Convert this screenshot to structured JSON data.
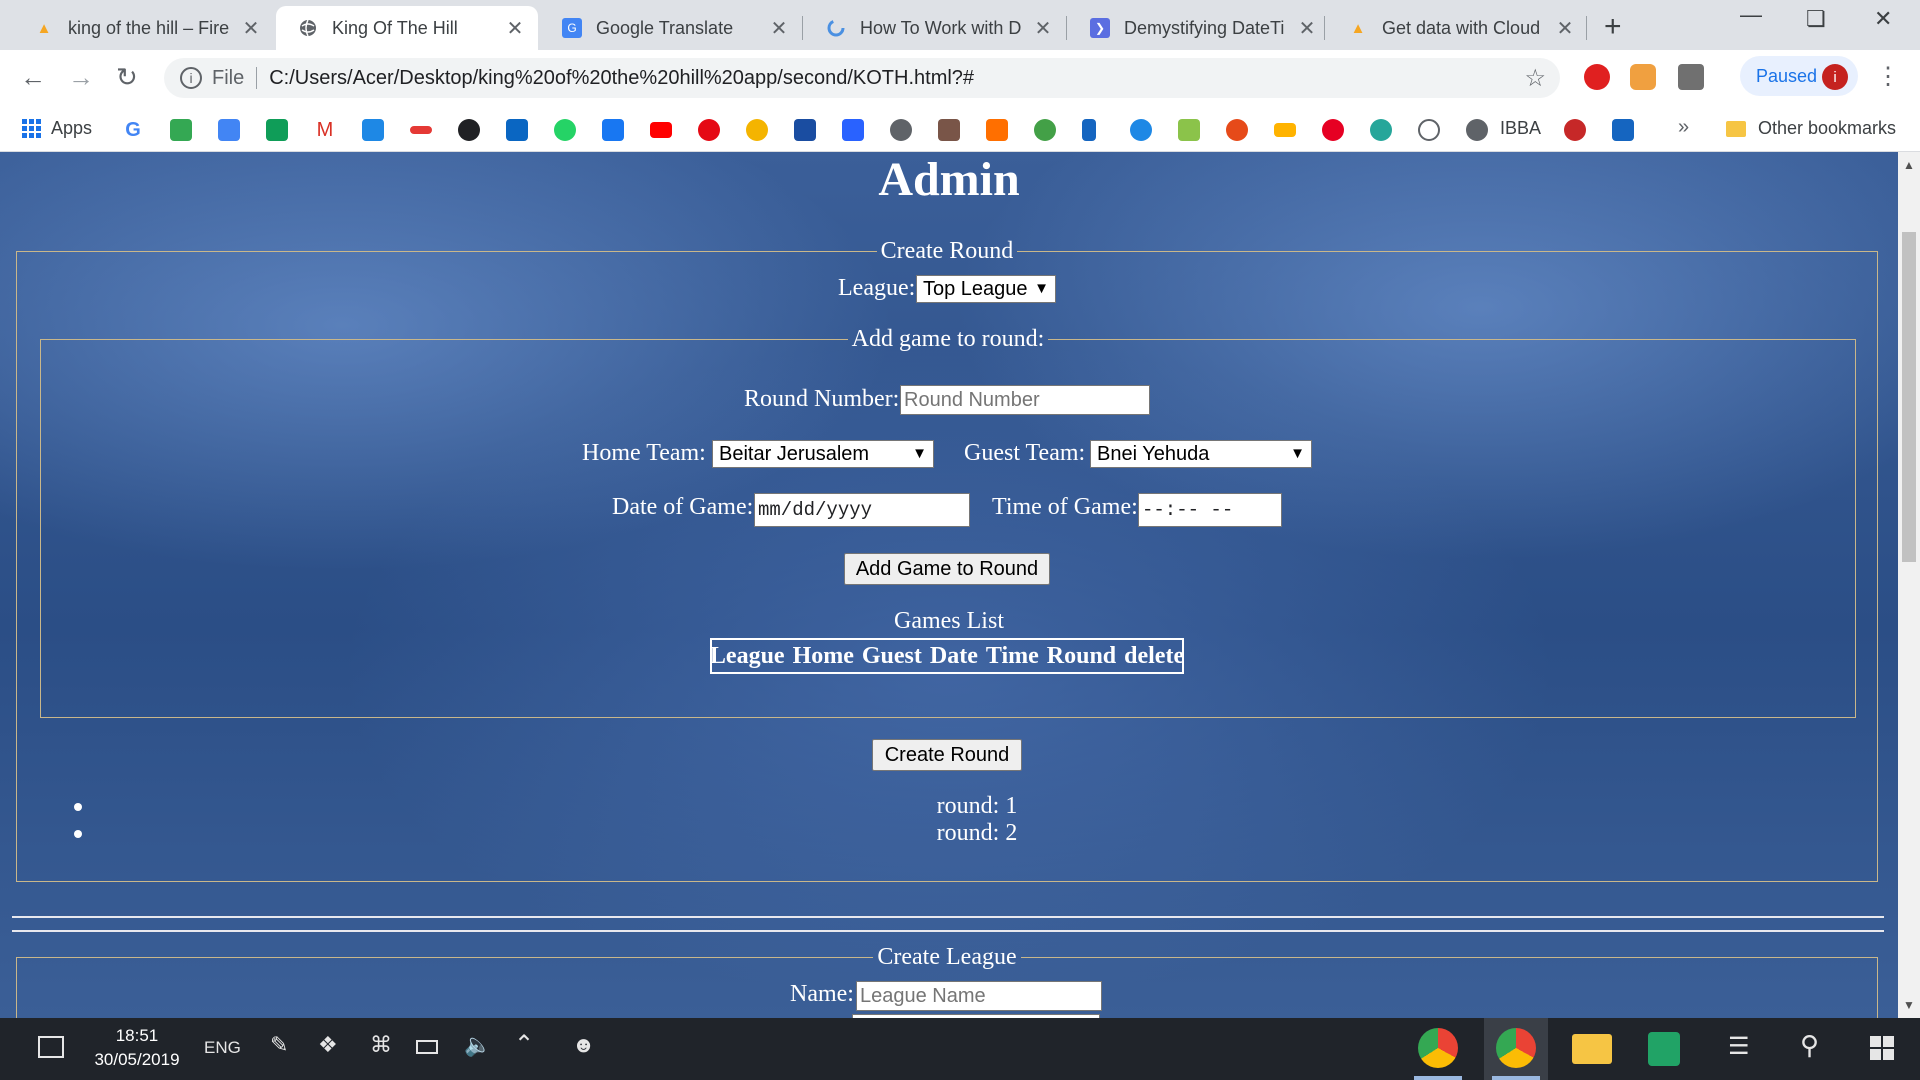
{
  "tabs": [
    {
      "title": "king of the hill – Fire",
      "icon": "firebase-icon",
      "active": false
    },
    {
      "title": "King Of The Hill",
      "icon": "globe-icon",
      "active": true
    },
    {
      "title": "Google Translate",
      "icon": "google-translate-icon",
      "active": false
    },
    {
      "title": "How To Work with D",
      "icon": "loading-spinner-icon",
      "active": false
    },
    {
      "title": "Demystifying DateTi",
      "icon": "article-icon",
      "active": false
    },
    {
      "title": "Get data with Cloud",
      "icon": "firebase-icon",
      "active": false
    }
  ],
  "omnibox": {
    "scheme_label": "File",
    "url": "C:/Users/Acer/Desktop/king%20of%20the%20hill%20app/second/KOTH.html?#"
  },
  "profile": {
    "label": "Paused",
    "avatar_letter": "i"
  },
  "bookmarks": {
    "apps_label": "Apps",
    "ibba_label": "IBBA",
    "other_label": "Other bookmarks",
    "more_label": "»"
  },
  "page": {
    "title": "Admin",
    "create_round": {
      "legend": "Create Round",
      "league_label": "League:",
      "league_value": "Top League",
      "add_game": {
        "legend": "Add game to round:",
        "round_number_label": "Round Number:",
        "round_number_placeholder": "Round Number",
        "home_team_label": "Home Team:",
        "home_team_value": "Beitar Jerusalem",
        "guest_team_label": "Guest Team:",
        "guest_team_value": "Bnei Yehuda",
        "date_label": "Date of Game:",
        "date_placeholder": "mm/dd/yyyy",
        "time_label": "Time of Game:",
        "time_placeholder": "--:-- --",
        "add_button": "Add Game to Round",
        "games_list_title": "Games List",
        "games_columns": [
          "League",
          "Home",
          "Guest",
          "Date",
          "Time",
          "Round",
          "delete"
        ]
      },
      "create_button": "Create Round",
      "rounds": [
        "round: 1",
        "round: 2"
      ]
    },
    "create_league": {
      "legend": "Create League",
      "name_label": "Name:",
      "name_placeholder": "League Name"
    }
  },
  "taskbar": {
    "time": "18:51",
    "date": "30/05/2019",
    "language": "ENG"
  }
}
